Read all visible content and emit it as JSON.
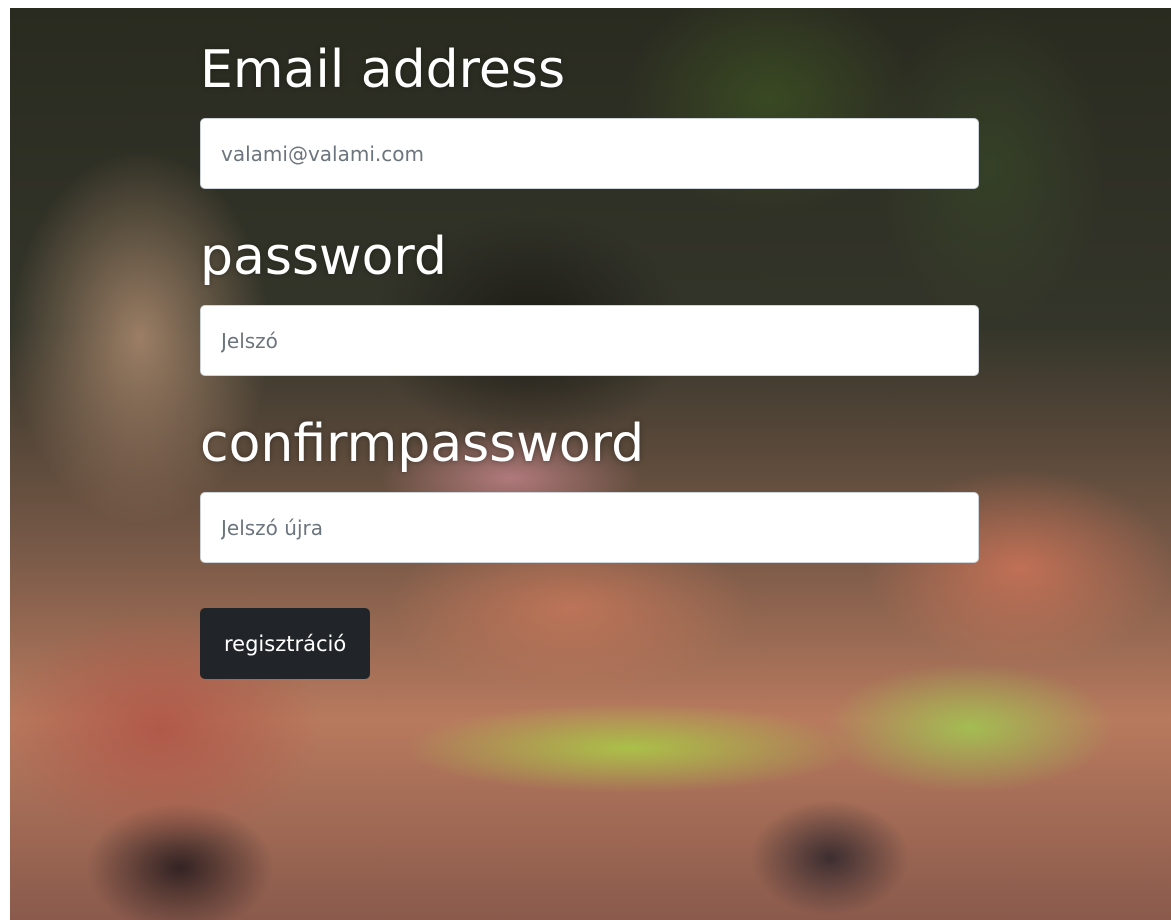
{
  "form": {
    "email": {
      "label": "Email address",
      "placeholder": "valami@valami.com",
      "value": ""
    },
    "password": {
      "label": "password",
      "placeholder": "Jelszó",
      "value": ""
    },
    "confirm_password": {
      "label": "confirmpassword",
      "placeholder": "Jelszó újra",
      "value": ""
    },
    "submit_label": "regisztráció"
  },
  "colors": {
    "button_bg": "#212529",
    "label_text": "#ffffff",
    "input_bg": "#ffffff"
  }
}
